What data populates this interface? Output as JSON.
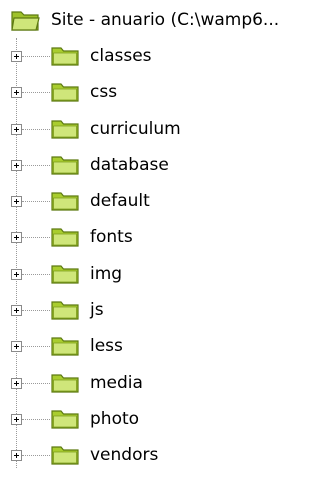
{
  "root": {
    "label": "Site - anuario (C:\\wamp6...",
    "icon": "folder-open-icon"
  },
  "folders": [
    {
      "label": "classes",
      "icon": "folder-icon",
      "expanded": false
    },
    {
      "label": "css",
      "icon": "folder-icon",
      "expanded": false
    },
    {
      "label": "curriculum",
      "icon": "folder-icon",
      "expanded": false
    },
    {
      "label": "database",
      "icon": "folder-icon",
      "expanded": false
    },
    {
      "label": "default",
      "icon": "folder-icon",
      "expanded": false
    },
    {
      "label": "fonts",
      "icon": "folder-icon",
      "expanded": false
    },
    {
      "label": "img",
      "icon": "folder-icon",
      "expanded": false
    },
    {
      "label": "js",
      "icon": "folder-icon",
      "expanded": false
    },
    {
      "label": "less",
      "icon": "folder-icon",
      "expanded": false
    },
    {
      "label": "media",
      "icon": "folder-icon",
      "expanded": false
    },
    {
      "label": "photo",
      "icon": "folder-icon",
      "expanded": false
    },
    {
      "label": "vendors",
      "icon": "folder-icon",
      "expanded": false
    }
  ],
  "colors": {
    "folder_fill": "#b2d235",
    "folder_light": "#d9ec8a",
    "folder_stroke": "#5d7a12",
    "tree_line": "#9a9a9a"
  }
}
